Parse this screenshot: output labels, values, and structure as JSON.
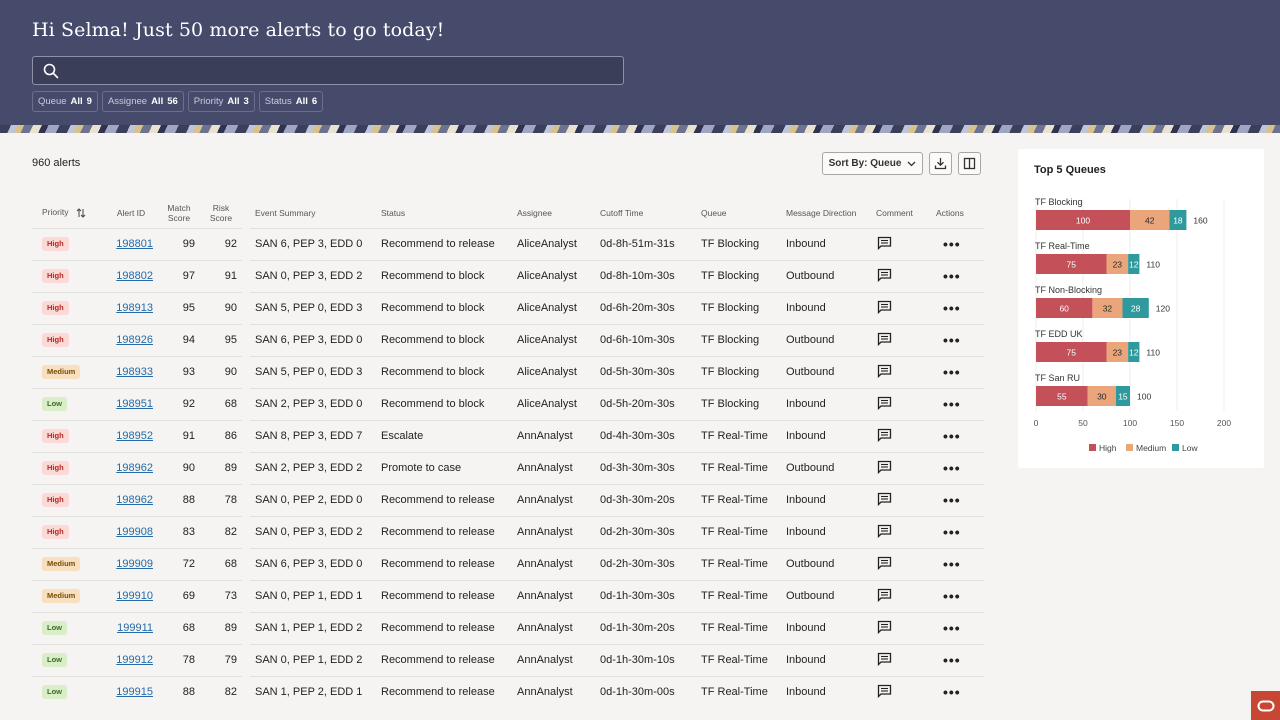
{
  "header": {
    "greeting": "Hi Selma! Just 50 more alerts to go today!",
    "search": {
      "placeholder": "",
      "value": ""
    },
    "filters": [
      {
        "label": "Queue",
        "value": "All",
        "count": "9"
      },
      {
        "label": "Assignee",
        "value": "All",
        "count": "56"
      },
      {
        "label": "Priority",
        "value": "All",
        "count": "3"
      },
      {
        "label": "Status",
        "value": "All",
        "count": "6"
      }
    ]
  },
  "main": {
    "alert_count": "960 alerts",
    "sort_label": "Sort By: Queue",
    "columns": [
      "Priority",
      "Alert ID",
      "Match Score",
      "Risk Score",
      "Event Summary",
      "Status",
      "Assignee",
      "Cutoff Time",
      "Queue",
      "Message Direction",
      "Comment",
      "Actions"
    ],
    "rows": [
      {
        "priority": "High",
        "alert_id": "198801",
        "match": "99",
        "risk": "92",
        "summary": "SAN 6, PEP 3, EDD 0",
        "status": "Recommend to release",
        "assignee": "AliceAnalyst",
        "cutoff": "0d-8h-51m-31s",
        "queue": "TF Blocking",
        "direction": "Inbound"
      },
      {
        "priority": "High",
        "alert_id": "198802",
        "match": "97",
        "risk": "91",
        "summary": "SAN 0, PEP 3, EDD 2",
        "status": "Recommend to block",
        "assignee": "AliceAnalyst",
        "cutoff": "0d-8h-10m-30s",
        "queue": "TF Blocking",
        "direction": "Outbound"
      },
      {
        "priority": "High",
        "alert_id": "198913",
        "match": "95",
        "risk": "90",
        "summary": "SAN 5, PEP 0, EDD 3",
        "status": "Recommend to block",
        "assignee": "AliceAnalyst",
        "cutoff": "0d-6h-20m-30s",
        "queue": "TF Blocking",
        "direction": "Inbound"
      },
      {
        "priority": "High",
        "alert_id": "198926",
        "match": "94",
        "risk": "95",
        "summary": "SAN 6, PEP 3, EDD 0",
        "status": "Recommend to block",
        "assignee": "AliceAnalyst",
        "cutoff": "0d-6h-10m-30s",
        "queue": "TF Blocking",
        "direction": "Outbound"
      },
      {
        "priority": "Medium",
        "alert_id": "198933",
        "match": "93",
        "risk": "90",
        "summary": "SAN 5, PEP 0, EDD 3",
        "status": "Recommend to block",
        "assignee": "AliceAnalyst",
        "cutoff": "0d-5h-30m-30s",
        "queue": "TF Blocking",
        "direction": "Outbound"
      },
      {
        "priority": "Low",
        "alert_id": "198951",
        "match": "92",
        "risk": "68",
        "summary": "SAN 2, PEP 3, EDD 0",
        "status": "Recommend to block",
        "assignee": "AliceAnalyst",
        "cutoff": "0d-5h-20m-30s",
        "queue": "TF Blocking",
        "direction": "Inbound"
      },
      {
        "priority": "High",
        "alert_id": "198952",
        "match": "91",
        "risk": "86",
        "summary": "SAN 8, PEP 3, EDD 7",
        "status": "Escalate",
        "assignee": "AnnAnalyst",
        "cutoff": "0d-4h-30m-30s",
        "queue": "TF Real-Time",
        "direction": "Inbound"
      },
      {
        "priority": "High",
        "alert_id": "198962",
        "match": "90",
        "risk": "89",
        "summary": "SAN 2, PEP 3, EDD 2",
        "status": "Promote to case",
        "assignee": "AnnAnalyst",
        "cutoff": "0d-3h-30m-30s",
        "queue": "TF Real-Time",
        "direction": "Outbound"
      },
      {
        "priority": "High",
        "alert_id": "198962",
        "match": "88",
        "risk": "78",
        "summary": "SAN 0, PEP 2, EDD 0",
        "status": "Recommend to release",
        "assignee": "AnnAnalyst",
        "cutoff": "0d-3h-30m-20s",
        "queue": "TF Real-Time",
        "direction": "Inbound"
      },
      {
        "priority": "High",
        "alert_id": "199908",
        "match": "83",
        "risk": "82",
        "summary": "SAN 0, PEP 3, EDD 2",
        "status": "Recommend to release",
        "assignee": "AnnAnalyst",
        "cutoff": "0d-2h-30m-30s",
        "queue": "TF Real-Time",
        "direction": "Inbound"
      },
      {
        "priority": "Medium",
        "alert_id": "199909",
        "match": "72",
        "risk": "68",
        "summary": "SAN 6, PEP 3, EDD 0",
        "status": "Recommend to release",
        "assignee": "AnnAnalyst",
        "cutoff": "0d-2h-30m-30s",
        "queue": "TF Real-Time",
        "direction": "Outbound"
      },
      {
        "priority": "Medium",
        "alert_id": "199910",
        "match": "69",
        "risk": "73",
        "summary": "SAN 0, PEP 1, EDD 1",
        "status": "Recommend to release",
        "assignee": "AnnAnalyst",
        "cutoff": "0d-1h-30m-30s",
        "queue": "TF Real-Time",
        "direction": "Outbound"
      },
      {
        "priority": "Low",
        "alert_id": "199911",
        "match": "68",
        "risk": "89",
        "summary": "SAN 1, PEP 1, EDD 2",
        "status": "Recommend to release",
        "assignee": "AnnAnalyst",
        "cutoff": "0d-1h-30m-20s",
        "queue": "TF Real-Time",
        "direction": "Inbound"
      },
      {
        "priority": "Low",
        "alert_id": "199912",
        "match": "78",
        "risk": "79",
        "summary": "SAN 0, PEP 1, EDD 2",
        "status": "Recommend to release",
        "assignee": "AnnAnalyst",
        "cutoff": "0d-1h-30m-10s",
        "queue": "TF Real-Time",
        "direction": "Inbound"
      },
      {
        "priority": "Low",
        "alert_id": "199915",
        "match": "88",
        "risk": "82",
        "summary": "SAN 1, PEP 2, EDD 1",
        "status": "Recommend to release",
        "assignee": "AnnAnalyst",
        "cutoff": "0d-1h-30m-00s",
        "queue": "TF Real-Time",
        "direction": "Inbound"
      }
    ]
  },
  "chart_data": {
    "type": "bar",
    "orientation": "horizontal",
    "stacked": true,
    "title": "Top 5 Queues",
    "categories": [
      "TF Blocking",
      "TF Real-Time",
      "TF Non-Blocking",
      "TF EDD UK",
      "TF San RU"
    ],
    "series": [
      {
        "name": "High",
        "color": "#c4515a",
        "values": [
          100,
          75,
          60,
          75,
          55
        ]
      },
      {
        "name": "Medium",
        "color": "#eaa57a",
        "values": [
          42,
          23,
          32,
          23,
          30
        ]
      },
      {
        "name": "Low",
        "color": "#2f9a9e",
        "values": [
          18,
          12,
          28,
          12,
          15
        ]
      }
    ],
    "totals": [
      160,
      110,
      120,
      110,
      100
    ],
    "xlim": [
      0,
      200
    ],
    "xticks": [
      0,
      50,
      100,
      150,
      200
    ],
    "grid": true,
    "legend_position": "bottom"
  },
  "colors": {
    "header_bg": "#464b6b",
    "link": "#266aa8",
    "brand": "#c74634"
  }
}
